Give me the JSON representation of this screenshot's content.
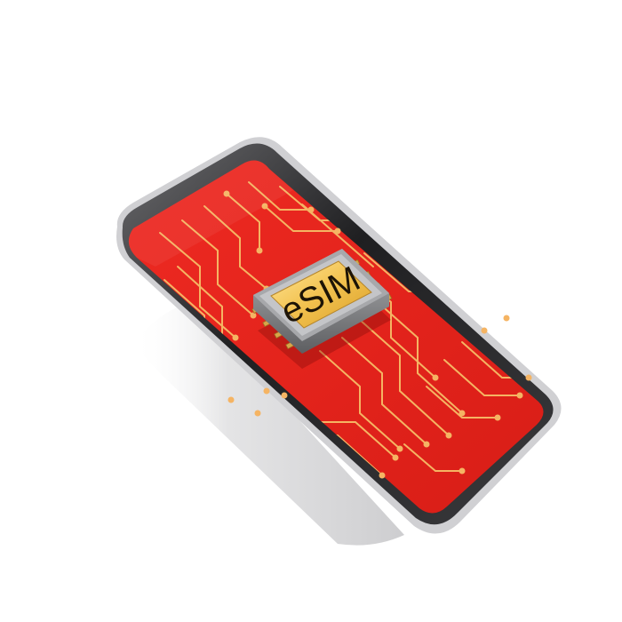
{
  "chip": {
    "label": "eSIM"
  },
  "colors": {
    "screen": "#e8231d",
    "screen_dark": "#c81812",
    "circuit": "#f5b463",
    "chip_gold": "#f2c14e",
    "chip_gold_light": "#ffe08a",
    "chip_body": "#8a8b8d",
    "phone_frame": "#2a2a2c",
    "phone_edge": "#c9c9cc"
  },
  "icons": [
    "smartphone-icon",
    "esim-chip-icon",
    "circuit-traces-icon"
  ]
}
